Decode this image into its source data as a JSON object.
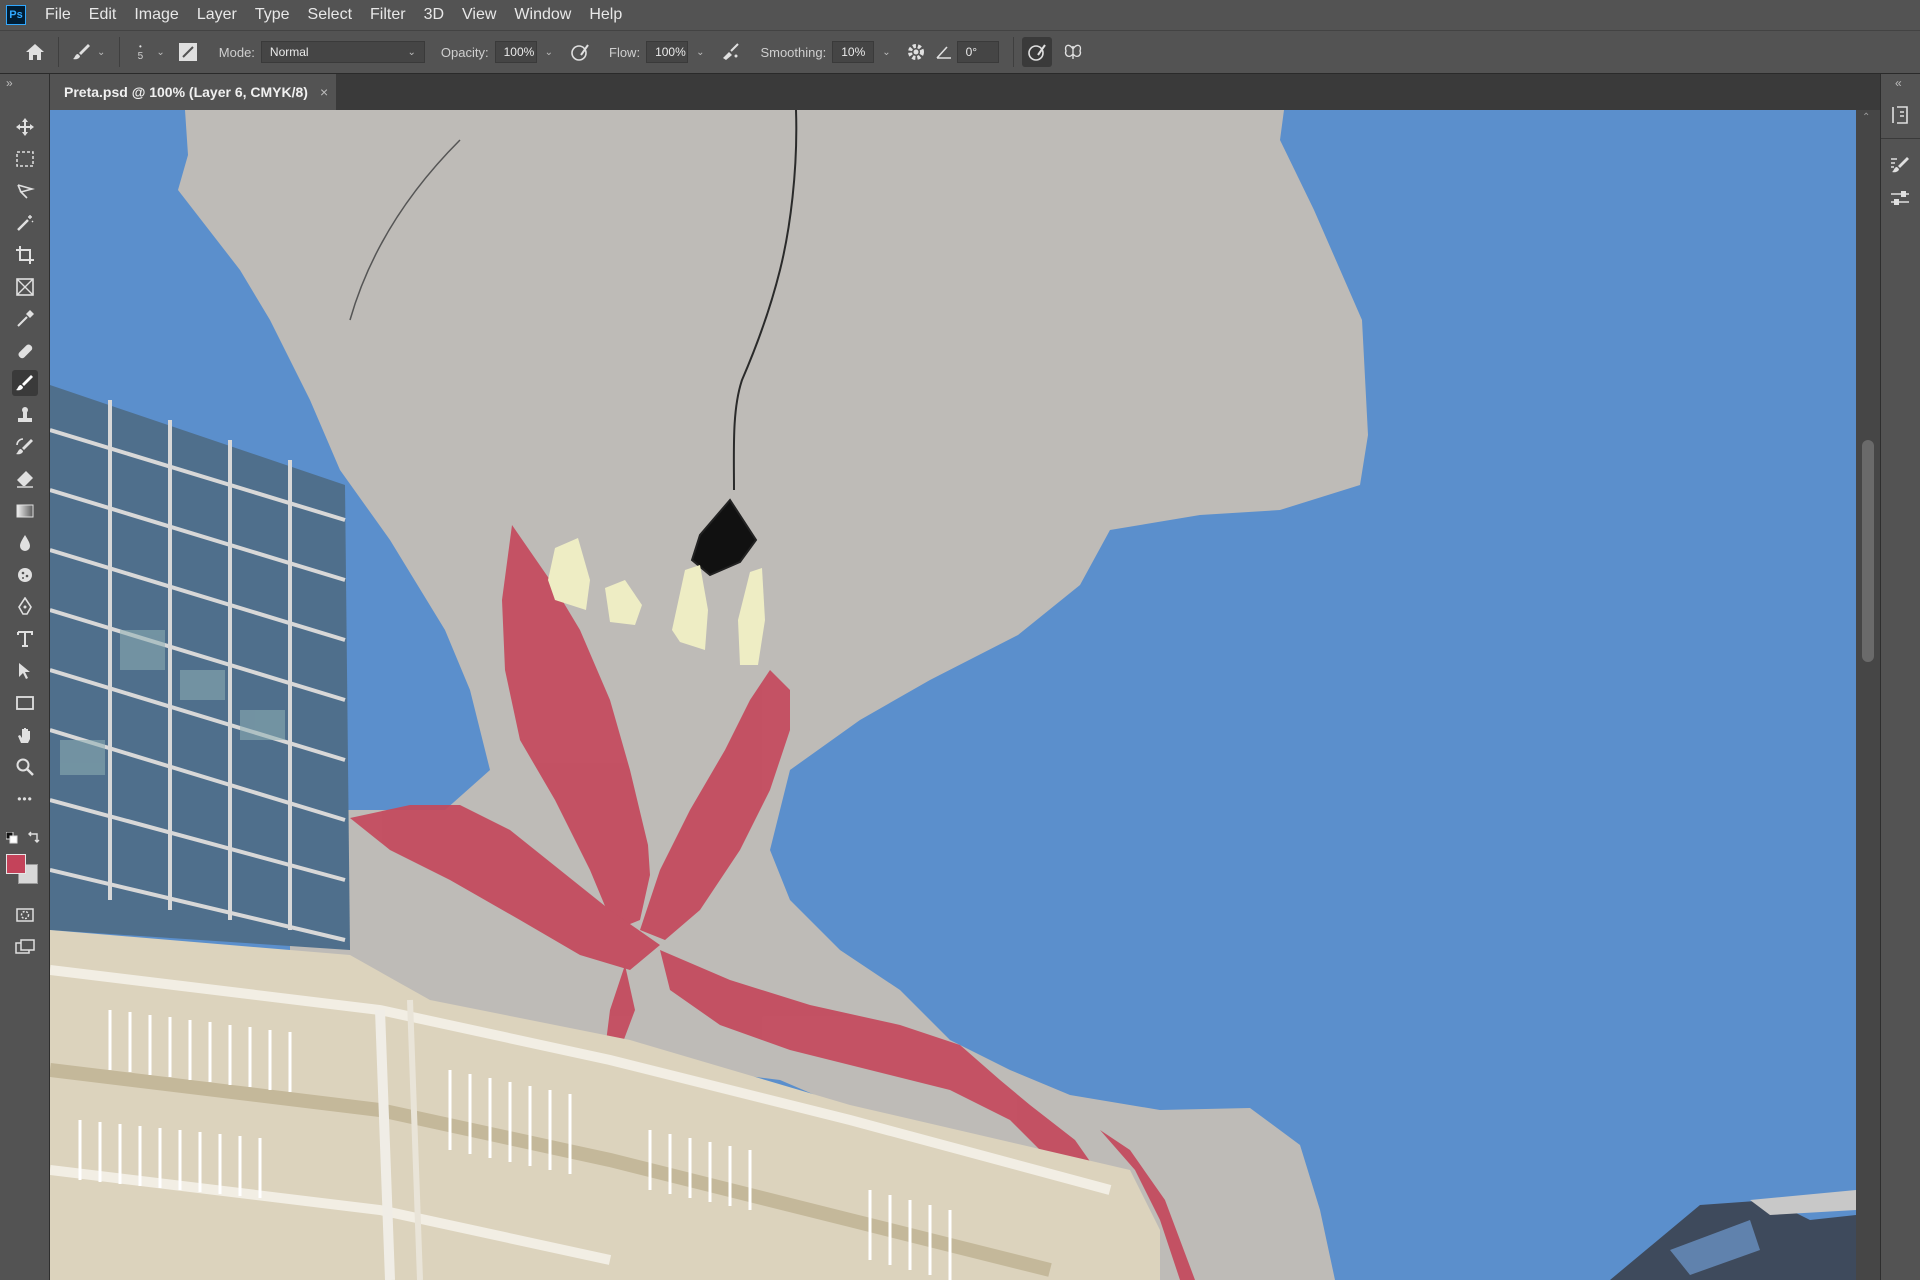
{
  "app": {
    "logo_text": "Ps"
  },
  "menu": [
    "File",
    "Edit",
    "Image",
    "Layer",
    "Type",
    "Select",
    "Filter",
    "3D",
    "View",
    "Window",
    "Help"
  ],
  "options": {
    "brush_size": "5",
    "mode_label": "Mode:",
    "mode_value": "Normal",
    "opacity_label": "Opacity:",
    "opacity_value": "100%",
    "flow_label": "Flow:",
    "flow_value": "100%",
    "smoothing_label": "Smoothing:",
    "smoothing_value": "10%",
    "angle_value": "0°"
  },
  "document": {
    "tab_title": "Preta.psd @ 100% (Layer 6, CMYK/8)",
    "close_glyph": "×"
  },
  "toolbar": {
    "active_tool": "brush-tool",
    "more_glyph": "•••"
  },
  "colors": {
    "foreground": "#c4435a",
    "background": "#d8d8d8",
    "sky": "#5b8fcc",
    "figure": "#bebbb7",
    "red_marks": "#c4495c",
    "teeth": "#eeedc4"
  }
}
